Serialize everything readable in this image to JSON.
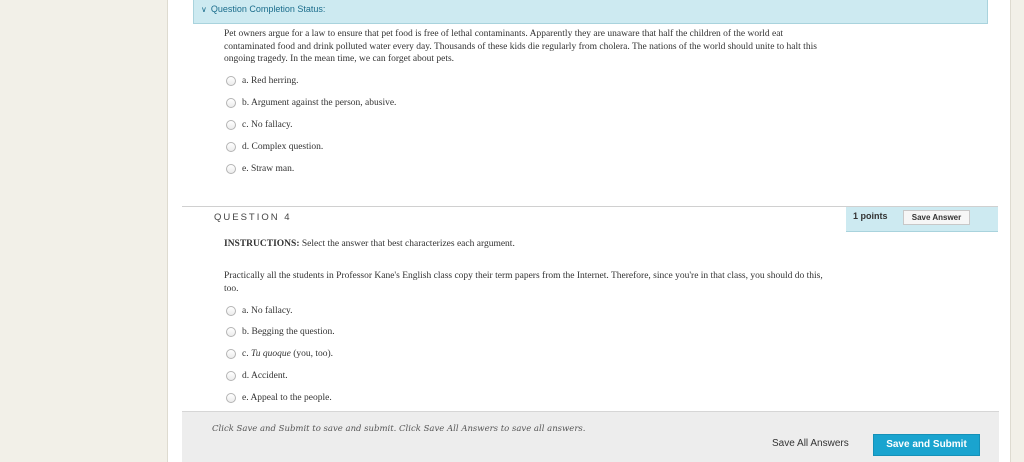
{
  "status_bar": {
    "chevron": "chevron-down-icon",
    "label": "Question Completion Status:"
  },
  "q3": {
    "text": "Pet owners argue for a law to ensure that pet food is free of lethal contaminants. Apparently they are unaware that half the children of the world eat contaminated food and drink polluted water every day. Thousands of these kids die regularly from cholera. The nations of the world should unite to halt this ongoing tragedy. In the mean time, we can forget about pets.",
    "options": [
      "a. Red herring.",
      "b. Argument against the person, abusive.",
      "c. No fallacy.",
      "d. Complex question.",
      "e. Straw man."
    ]
  },
  "q4": {
    "title": "QUESTION 4",
    "points": "1 points",
    "save_label": "Save Answer",
    "instructions_label": "INSTRUCTIONS:",
    "instructions_text": " Select the answer that best characterizes each argument.",
    "text": "Practically all the students in Professor Kane's English class copy their term papers from the Internet. Therefore, since you're in that class, you should do this, too.",
    "options": [
      "a. No fallacy.",
      "b. Begging the question.",
      "c. ",
      "d. Accident.",
      "e. Appeal to the people."
    ],
    "option_c_italic": "Tu quoque",
    "option_c_rest": " (you, too)."
  },
  "footer": {
    "hint": "Click Save and Submit to save and submit. Click Save All Answers to save all answers.",
    "save_all_label": "Save All Answers",
    "submit_label": "Save and Submit"
  }
}
